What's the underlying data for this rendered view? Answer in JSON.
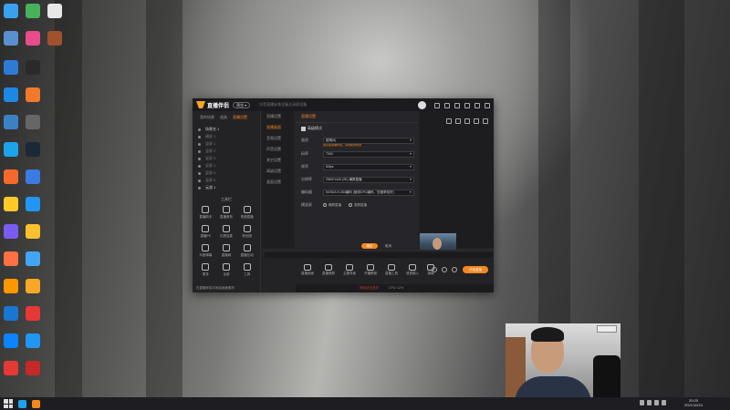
{
  "app": {
    "logo_text": "直播伴侣",
    "version": "预览 ▾",
    "title_hint": "抖音直播安装设备及录屏设备",
    "left_tabs": [
      "我的场景",
      "道具",
      "直播设置"
    ],
    "active_left_tab": "直播设置",
    "scenes": [
      "场景名 1",
      "横屏 1",
      "竖屏 1",
      "竖屏 2",
      "竖屏 3",
      "竖屏 4",
      "竖屏 5",
      "竖屏 6",
      "云游 1"
    ],
    "tools_label": "工具栏",
    "tools": [
      "直播助手",
      "直播音效",
      "视频直播",
      "直播PK",
      "礼物连麦",
      "粉丝团",
      "抖音弹幕",
      "直播间",
      "直播互动",
      "更多",
      "全部",
      "工具"
    ],
    "bottom_notice": "在直播伴侣中添加画面素材",
    "settings": {
      "header": "直播设置",
      "side_items": [
        "直播设置",
        "直播画面",
        "音频设置",
        "声音设置",
        "其它设置",
        "高级设置",
        "画面设置"
      ],
      "active_side": "直播画面",
      "checkbox_label": "高级模式",
      "rows": [
        {
          "label": "画质",
          "value": "超清(5)"
        },
        {
          "label": "码率",
          "value": "7000"
        },
        {
          "label": "帧率",
          "value": "60fps"
        },
        {
          "label": "分辨率",
          "value": "2560*1440 (2K) 横屏直播"
        },
        {
          "label": "编码器",
          "value": "NVIDIA H.264编码 (使用GPU编码，压缩率较好)"
        }
      ],
      "hint": "建议使用推荐值，请勿随意修改",
      "radio_label": "横竖屏",
      "radio_options": [
        "横屏直播",
        "竖屏直播"
      ],
      "ok": "确定",
      "cancel": "取消"
    },
    "bottom_tools": [
      "直播画面",
      "直播美颜",
      "主题背景",
      "开播教程",
      "直播工具",
      "语音输入",
      "弹幕"
    ],
    "live_button": "开始直播",
    "status_text": "网络状态良好",
    "status_extra": "CPU: 12%"
  },
  "taskbar": {
    "time": "20:20",
    "date": "2021/10/24"
  },
  "colors": {
    "accent": "#f5871f",
    "window_bg": "#232326",
    "titlebar_bg": "#1b1b1e"
  }
}
